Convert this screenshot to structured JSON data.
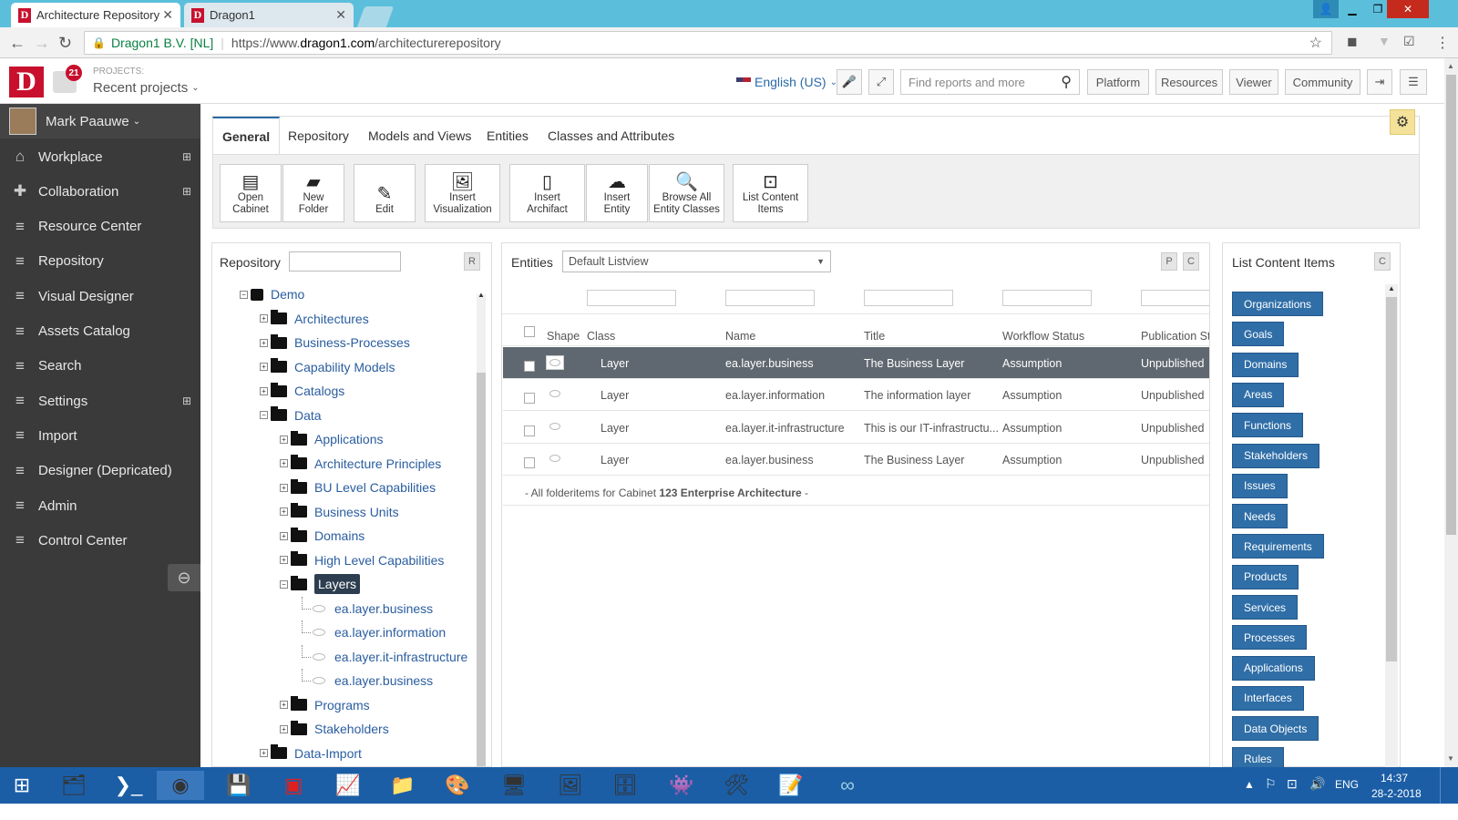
{
  "browser": {
    "tabs": [
      {
        "title": "Architecture Repository",
        "favicon": "D"
      },
      {
        "title": "Dragon1",
        "favicon": "D"
      }
    ],
    "site_name": "Dragon1 B.V. [NL]",
    "url_prefix": "https://www.",
    "url_domain": "dragon1.com",
    "url_path": "/architecturerepository"
  },
  "header": {
    "logo": "D",
    "notif_count": "21",
    "projects_label": "PROJECTS:",
    "recent_projects": "Recent projects",
    "language": "English (US)",
    "search_placeholder": "Find reports and more",
    "nav": [
      "Platform",
      "Resources",
      "Viewer",
      "Community"
    ]
  },
  "sidebar": {
    "user": "Mark Paauwe",
    "items": [
      {
        "label": "Workplace",
        "icon": "home-icon",
        "plus": "⊞"
      },
      {
        "label": "Collaboration",
        "icon": "puzzle-icon",
        "plus": "⊞"
      },
      {
        "label": "Resource Center",
        "icon": "list-icon"
      },
      {
        "label": "Repository",
        "icon": "list-icon"
      },
      {
        "label": "Visual Designer",
        "icon": "list-icon"
      },
      {
        "label": "Assets Catalog",
        "icon": "list-icon"
      },
      {
        "label": "Search",
        "icon": "list-icon"
      },
      {
        "label": "Settings",
        "icon": "list-icon",
        "plus": "⊞"
      },
      {
        "label": "Import",
        "icon": "list-icon"
      },
      {
        "label": "Designer (Depricated)",
        "icon": "list-icon"
      },
      {
        "label": "Admin",
        "icon": "list-icon"
      },
      {
        "label": "Control Center",
        "icon": "list-icon"
      }
    ]
  },
  "main_tabs": [
    "General",
    "Repository",
    "Models and Views",
    "Entities",
    "Classes and Attributes"
  ],
  "toolbar": [
    {
      "line1": "Open",
      "line2": "Cabinet",
      "icon": "cabinet-icon"
    },
    {
      "line1": "New",
      "line2": "Folder",
      "icon": "folder-icon"
    },
    {
      "line1": "Edit",
      "line2": "",
      "icon": "edit-icon"
    },
    {
      "line1": "Insert",
      "line2": "Visualization",
      "icon": "image-icon"
    },
    {
      "line1": "Insert",
      "line2": "Archifact",
      "icon": "file-icon"
    },
    {
      "line1": "Insert",
      "line2": "Entity",
      "icon": "cloud-icon"
    },
    {
      "line1": "Browse All",
      "line2": "Entity Classes",
      "icon": "search-icon"
    },
    {
      "line1": "List Content",
      "line2": "Items",
      "icon": "dropdown-icon"
    }
  ],
  "repository": {
    "label": "Repository",
    "btn": "R",
    "tree": [
      {
        "label": "Demo",
        "level": 0,
        "exp": "−",
        "type": "cabinet"
      },
      {
        "label": "Architectures",
        "level": 1,
        "exp": "+",
        "type": "folder"
      },
      {
        "label": "Business-Processes",
        "level": 1,
        "exp": "+",
        "type": "folder"
      },
      {
        "label": "Capability Models",
        "level": 1,
        "exp": "+",
        "type": "folder"
      },
      {
        "label": "Catalogs",
        "level": 1,
        "exp": "+",
        "type": "folder"
      },
      {
        "label": "Data",
        "level": 1,
        "exp": "−",
        "type": "folder"
      },
      {
        "label": "Applications",
        "level": 2,
        "exp": "+",
        "type": "folder"
      },
      {
        "label": "Architecture Principles",
        "level": 2,
        "exp": "+",
        "type": "folder"
      },
      {
        "label": "BU Level Capabilities",
        "level": 2,
        "exp": "+",
        "type": "folder"
      },
      {
        "label": "Business Units",
        "level": 2,
        "exp": "+",
        "type": "folder"
      },
      {
        "label": "Domains",
        "level": 2,
        "exp": "+",
        "type": "folder"
      },
      {
        "label": "High Level Capabilities",
        "level": 2,
        "exp": "+",
        "type": "folder"
      },
      {
        "label": "Layers",
        "level": 2,
        "exp": "−",
        "type": "folder",
        "selected": true
      },
      {
        "label": "ea.layer.business",
        "level": 3,
        "type": "shape"
      },
      {
        "label": "ea.layer.information",
        "level": 3,
        "type": "shape"
      },
      {
        "label": "ea.layer.it-infrastructure",
        "level": 3,
        "type": "shape"
      },
      {
        "label": "ea.layer.business",
        "level": 3,
        "type": "shape"
      },
      {
        "label": "Programs",
        "level": 2,
        "exp": "+",
        "type": "folder"
      },
      {
        "label": "Stakeholders",
        "level": 2,
        "exp": "+",
        "type": "folder"
      },
      {
        "label": "Data-Import",
        "level": 1,
        "exp": "+",
        "type": "folder"
      }
    ]
  },
  "entities": {
    "label": "Entities",
    "listview": "Default Listview",
    "btn_p": "P",
    "btn_c": "C",
    "columns": [
      "Shape",
      "Class",
      "Name",
      "Title",
      "Workflow Status",
      "Publication St"
    ],
    "rows": [
      {
        "class": "Layer",
        "name": "ea.layer.business",
        "title": "The Business Layer",
        "status": "Assumption",
        "pub": "Unpublished",
        "selected": true
      },
      {
        "class": "Layer",
        "name": "ea.layer.information",
        "title": "The information layer",
        "status": "Assumption",
        "pub": "Unpublished"
      },
      {
        "class": "Layer",
        "name": "ea.layer.it-infrastructure",
        "title": "This is our IT-infrastructu...",
        "status": "Assumption",
        "pub": "Unpublished"
      },
      {
        "class": "Layer",
        "name": "ea.layer.business",
        "title": "The Business Layer",
        "status": "Assumption",
        "pub": "Unpublished"
      }
    ],
    "footer_pre": "- All folderitems for Cabinet ",
    "footer_bold": "123 Enterprise Architecture",
    "footer_post": " -"
  },
  "list_content": {
    "label": "List Content Items",
    "btn": "C",
    "items": [
      "Organizations",
      "Goals",
      "Domains",
      "Areas",
      "Functions",
      "Stakeholders",
      "Issues",
      "Needs",
      "Requirements",
      "Products",
      "Services",
      "Processes",
      "Applications",
      "Interfaces",
      "Data Objects",
      "Rules"
    ]
  },
  "taskbar": {
    "lang": "ENG",
    "time": "14:37",
    "date": "28-2-2018"
  },
  "colors": {
    "brand": "#c8102e",
    "sidebar": "#3a3a3a",
    "accent": "#2f6ea7",
    "selected_row": "#5f6870"
  }
}
